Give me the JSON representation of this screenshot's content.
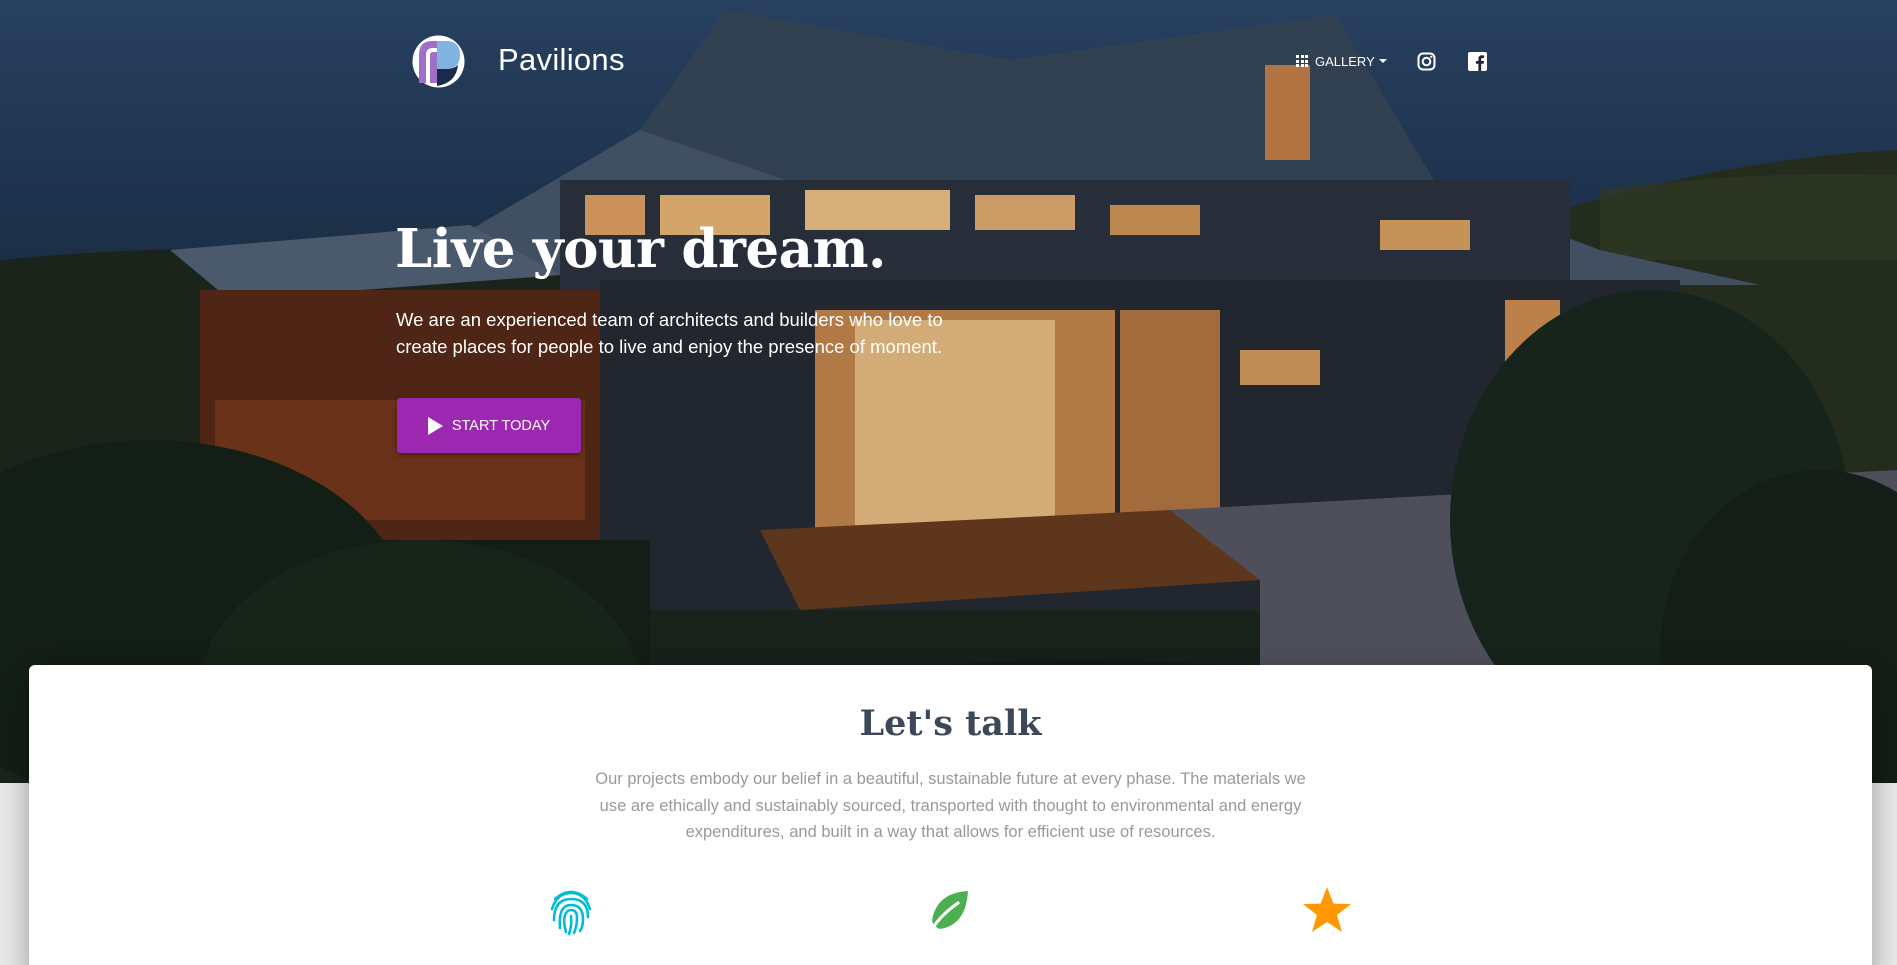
{
  "brand": {
    "name": "Pavilions",
    "logo_icon": "pavilions-logo-icon"
  },
  "nav": {
    "gallery_label": "GALLERY",
    "gallery_icon": "apps-grid-icon",
    "instagram_icon": "instagram-icon",
    "facebook_icon": "facebook-icon"
  },
  "hero": {
    "title": "Live your dream.",
    "subtitle": "We are an experienced team of architects and builders who love to create places for people to live and enjoy the presence of moment.",
    "cta_label": "START TODAY",
    "cta_icon": "play-icon",
    "background": "house-at-dusk-photo"
  },
  "section": {
    "title": "Let's talk",
    "text": "Our projects embody our belief in a beautiful, sustainable future at every phase. The materials we use are ethically and sustainably sourced, transported with thought to environmental and energy expenditures, and built in a way that allows for efficient use of resources.",
    "features": [
      {
        "icon": "fingerprint-icon",
        "color": "#00bcd4"
      },
      {
        "icon": "leaf-icon",
        "color": "#4caf50"
      },
      {
        "icon": "star-icon",
        "color": "#ff9800"
      }
    ]
  },
  "colors": {
    "primary": "#9c27b0",
    "title": "#3c4858",
    "muted": "#999999"
  }
}
